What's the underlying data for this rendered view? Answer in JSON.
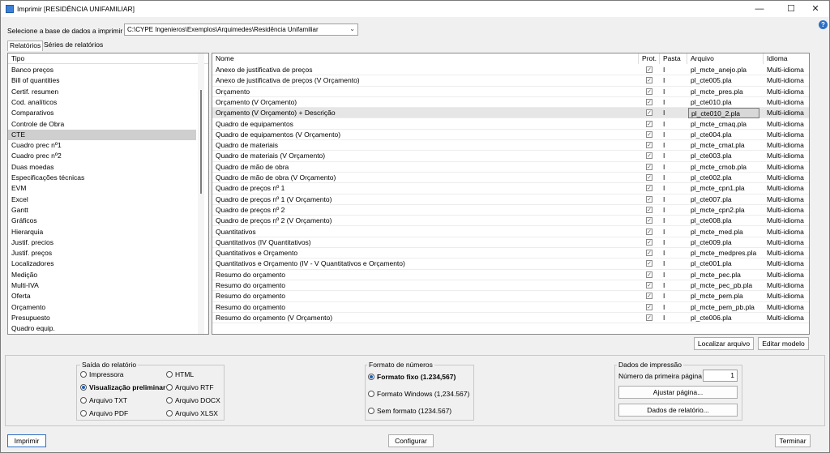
{
  "window": {
    "title": "Imprimir [RESIDÊNCIA UNIFAMILIAR]",
    "minimize_glyph": "—",
    "maximize_glyph": "☐",
    "close_glyph": "✕",
    "help_glyph": "?"
  },
  "database": {
    "label": "Selecione a base de dados a imprimir",
    "path": "C:\\CYPE Ingenieros\\Exemplos\\Arquimedes\\Residência Unifamiliar"
  },
  "tabs": [
    "Relatórios",
    "Séries de relatórios"
  ],
  "types": {
    "header": "Tipo",
    "items": [
      "Banco preços",
      "Bill of quantities",
      "Certif. resumen",
      "Cod. analíticos",
      "Comparativos",
      "Controle de Obra",
      "CTE",
      "Cuadro prec nº1",
      "Cuadro prec nº2",
      "Duas moedas",
      "Especificações técnicas",
      "EVM",
      "Excel",
      "Gantt",
      "Gráficos",
      "Hierarquia",
      "Justif. precios",
      "Justif. preços",
      "Localizadores",
      "Medição",
      "Multi-IVA",
      "Oferta",
      "Orçamento",
      "Presupuesto",
      "Quadro equip."
    ],
    "selected_index": 6
  },
  "reports": {
    "headers": {
      "name": "Nome",
      "prot": "Prot.",
      "folder": "Pasta",
      "file": "Arquivo",
      "lang": "Idioma"
    },
    "rows": [
      {
        "name": "Anexo de justificativa de preços",
        "folder": "I",
        "file": "pl_mcte_anejo.pla",
        "lang": "Multi-idioma"
      },
      {
        "name": "Anexo de justificativa de preços (V  Orçamento)",
        "folder": "I",
        "file": "pl_cte005.pla",
        "lang": "Multi-idioma"
      },
      {
        "name": "Orçamento",
        "folder": "I",
        "file": "pl_mcte_pres.pla",
        "lang": "Multi-idioma"
      },
      {
        "name": "Orçamento (V Orçamento)",
        "folder": "I",
        "file": "pl_cte010.pla",
        "lang": "Multi-idioma"
      },
      {
        "name": "Orçamento (V Orçamento) + Descrição",
        "folder": "I",
        "file": "pl_cte010_2.pla",
        "lang": "Multi-idioma"
      },
      {
        "name": "Quadro de equipamentos",
        "folder": "I",
        "file": "pl_mcte_cmaq.pla",
        "lang": "Multi-idioma"
      },
      {
        "name": "Quadro de equipamentos (V  Orçamento)",
        "folder": "I",
        "file": "pl_cte004.pla",
        "lang": "Multi-idioma"
      },
      {
        "name": "Quadro de materiais",
        "folder": "I",
        "file": "pl_mcte_cmat.pla",
        "lang": "Multi-idioma"
      },
      {
        "name": "Quadro de materiais (V  Orçamento)",
        "folder": "I",
        "file": "pl_cte003.pla",
        "lang": "Multi-idioma"
      },
      {
        "name": "Quadro de mão de obra",
        "folder": "I",
        "file": "pl_mcte_cmob.pla",
        "lang": "Multi-idioma"
      },
      {
        "name": "Quadro de mão de obra (V  Orçamento)",
        "folder": "I",
        "file": "pl_cte002.pla",
        "lang": "Multi-idioma"
      },
      {
        "name": "Quadro de preços nº 1",
        "folder": "I",
        "file": "pl_mcte_cpn1.pla",
        "lang": "Multi-idioma"
      },
      {
        "name": "Quadro de preços nº 1 (V  Orçamento)",
        "folder": "I",
        "file": "pl_cte007.pla",
        "lang": "Multi-idioma"
      },
      {
        "name": "Quadro de preços nº 2",
        "folder": "I",
        "file": "pl_mcte_cpn2.pla",
        "lang": "Multi-idioma"
      },
      {
        "name": "Quadro de preços nº 2 (V Orçamento)",
        "folder": "I",
        "file": "pl_cte008.pla",
        "lang": "Multi-idioma"
      },
      {
        "name": "Quantitativos",
        "folder": "I",
        "file": "pl_mcte_med.pla",
        "lang": "Multi-idioma"
      },
      {
        "name": "Quantitativos (IV Quantitativos)",
        "folder": "I",
        "file": "pl_cte009.pla",
        "lang": "Multi-idioma"
      },
      {
        "name": "Quantitativos e Orçamento",
        "folder": "I",
        "file": "pl_mcte_medpres.pla",
        "lang": "Multi-idioma"
      },
      {
        "name": "Quantitativos e Orçamento (IV - V Quantitativos e Orçamento)",
        "folder": "I",
        "file": "pl_cte001.pla",
        "lang": "Multi-idioma"
      },
      {
        "name": "Resumo do orçamento",
        "folder": "I",
        "file": "pl_mcte_pec.pla",
        "lang": "Multi-idioma"
      },
      {
        "name": "Resumo do orçamento",
        "folder": "I",
        "file": "pl_mcte_pec_pb.pla",
        "lang": "Multi-idioma"
      },
      {
        "name": "Resumo do orçamento",
        "folder": "I",
        "file": "pl_mcte_pem.pla",
        "lang": "Multi-idioma"
      },
      {
        "name": "Resumo do orçamento",
        "folder": "I",
        "file": "pl_mcte_pem_pb.pla",
        "lang": "Multi-idioma"
      },
      {
        "name": "Resumo do orçamento (V  Orçamento)",
        "folder": "I",
        "file": "pl_cte006.pla",
        "lang": "Multi-idioma"
      }
    ],
    "selected_index": 4,
    "check_glyph": "✓"
  },
  "actions": {
    "locate": "Localizar arquivo",
    "edit": "Editar modelo"
  },
  "output": {
    "title": "Saída do relatório",
    "options": [
      "Impressora",
      "Visualização preliminar",
      "Arquivo TXT",
      "Arquivo PDF",
      "HTML",
      "Arquivo RTF",
      "Arquivo DOCX",
      "Arquivo XLSX"
    ],
    "selected": "Visualização preliminar"
  },
  "numbers": {
    "title": "Formato de números",
    "options": [
      "Formato fixo (1.234,567)",
      "Formato Windows (1,234.567)",
      "Sem formato (1234.567)"
    ],
    "selected": "Formato fixo (1.234,567)"
  },
  "print_data": {
    "title": "Dados de impressão",
    "first_page_label": "Número da primeira página",
    "first_page_value": "1",
    "adjust_page": "Ajustar página...",
    "report_data": "Dados de relatório..."
  },
  "footer": {
    "print": "Imprimir",
    "configure": "Configurar",
    "finish": "Terminar"
  }
}
